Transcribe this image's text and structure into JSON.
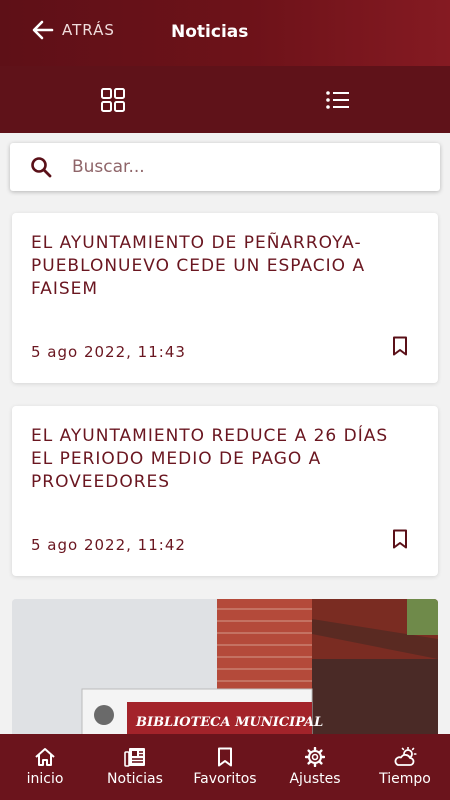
{
  "header": {
    "back_label": "ATRÁS",
    "title": "Noticias"
  },
  "search": {
    "placeholder": "Buscar..."
  },
  "news": [
    {
      "title": "EL AYUNTAMIENTO DE PEÑARROYA-PUEBLONUEVO CEDE UN ESPACIO A FAISEM",
      "date": "5 ago 2022, 11:43"
    },
    {
      "title": "EL AYUNTAMIENTO REDUCE A 26 DÍAS EL PERIODO MEDIO DE PAGO A PROVEEDORES",
      "date": "5 ago 2022, 11:42"
    }
  ],
  "photo_sign": {
    "text": "BIBLIOTECA MUNICIPAL"
  },
  "nav": {
    "items": [
      {
        "label": "inicio",
        "icon": "home-icon"
      },
      {
        "label": "Noticias",
        "icon": "newspaper-icon"
      },
      {
        "label": "Favoritos",
        "icon": "bookmark-icon"
      },
      {
        "label": "Ajustes",
        "icon": "gear-icon"
      },
      {
        "label": "Tiempo",
        "icon": "weather-icon"
      }
    ]
  },
  "colors": {
    "primary": "#6b141c",
    "text_accent": "#6a1620"
  }
}
